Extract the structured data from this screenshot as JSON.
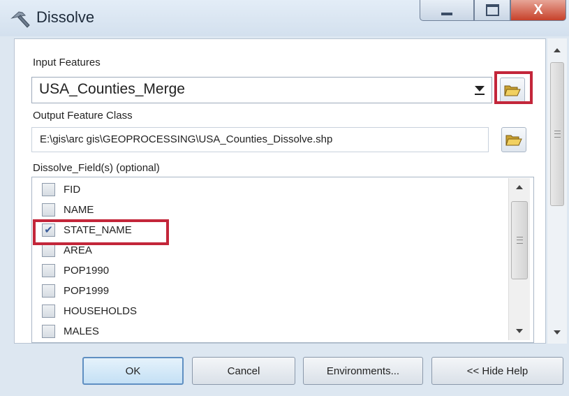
{
  "window": {
    "title": "Dissolve",
    "close_glyph": "X",
    "icons": {
      "app": "hammer-icon",
      "minimize": "minimize-icon",
      "maximize": "maximize-icon",
      "close": "close-icon"
    }
  },
  "form": {
    "input_features": {
      "label": "Input Features",
      "value": "USA_Counties_Merge"
    },
    "output_feature_class": {
      "label": "Output Feature Class",
      "value": "E:\\gis\\arc gis\\GEOPROCESSING\\USA_Counties_Dissolve.shp"
    },
    "dissolve_fields": {
      "label": "Dissolve_Field(s) (optional)",
      "items": [
        {
          "label": "FID",
          "checked": false
        },
        {
          "label": "NAME",
          "checked": false
        },
        {
          "label": "STATE_NAME",
          "checked": true
        },
        {
          "label": "AREA",
          "checked": false
        },
        {
          "label": "POP1990",
          "checked": false
        },
        {
          "label": "POP1999",
          "checked": false
        },
        {
          "label": "HOUSEHOLDS",
          "checked": false
        },
        {
          "label": "MALES",
          "checked": false
        }
      ]
    },
    "browse_icon": "folder-open-icon"
  },
  "buttons": {
    "ok": "OK",
    "cancel": "Cancel",
    "environments": "Environments...",
    "hide_help": "<< Hide Help"
  },
  "colors": {
    "highlight": "#c3263a",
    "window_background": "#dde7f1",
    "default_button": "#c4e0f5"
  }
}
